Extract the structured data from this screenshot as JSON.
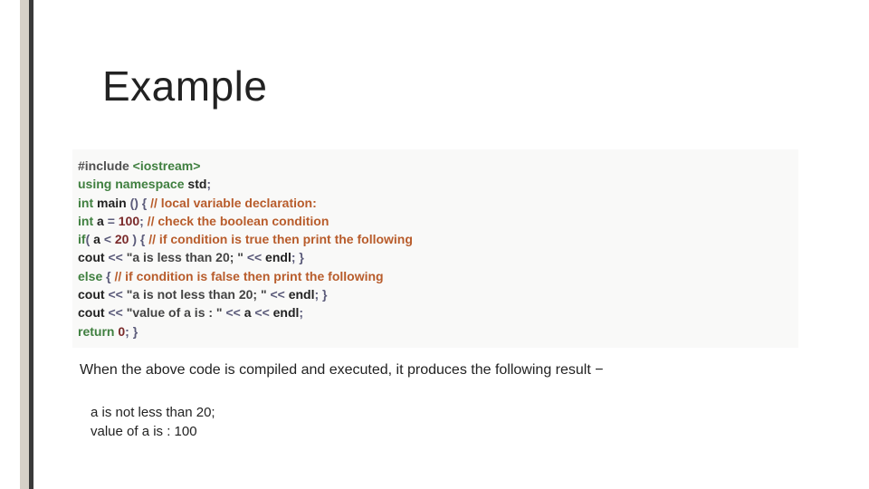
{
  "title": "Example",
  "code": {
    "l1": {
      "pre": "#include",
      "inc": " <iostream>"
    },
    "l2": {
      "kw1": "using",
      "kw2": " namespace",
      "id": " std",
      "p": ";"
    },
    "l3": {
      "kw": "int",
      "id": " main ",
      "p1": "()",
      "p2": " {",
      "cmt": " // local variable declaration:"
    },
    "l4": {
      "kw": "int",
      "id": " a ",
      "p1": "=",
      "num": " 100",
      "p2": ";",
      "cmt": " // check the boolean condition"
    },
    "l5": {
      "kw": "if",
      "p1": "(",
      "id": " a ",
      "p2": "<",
      "num": " 20 ",
      "p3": ")",
      "p4": " {",
      "cmt": " // if condition is true then print the following"
    },
    "l6": {
      "id": "cout ",
      "p1": "<<",
      "str": " \"a is less than 20; \" ",
      "p2": "<<",
      "id2": " endl",
      "p3": ";",
      "p4": " }"
    },
    "l7": {
      "kw": "else",
      "p1": " {",
      "cmt": " // if condition is false then print the following"
    },
    "l8": {
      "id": "cout ",
      "p1": "<<",
      "str": " \"a is not less than 20; \" ",
      "p2": "<<",
      "id2": " endl",
      "p3": ";",
      "p4": " }"
    },
    "l9": {
      "id": "cout ",
      "p1": "<<",
      "str": " \"value of a is : \" ",
      "p2": "<<",
      "id2": " a ",
      "p3": "<<",
      "id3": " endl",
      "p4": ";"
    },
    "l10": {
      "kw": "return",
      "num": " 0",
      "p1": ";",
      "p2": " }"
    }
  },
  "result_intro": "When the above code is compiled and executed, it produces the following result −",
  "output": {
    "l1": "a is not less than 20;",
    "l2": "value of a is : 100"
  }
}
